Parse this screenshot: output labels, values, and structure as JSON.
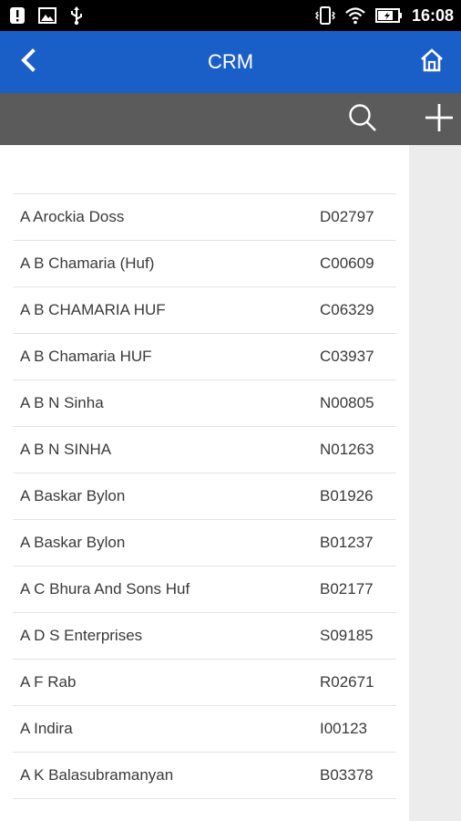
{
  "status_bar": {
    "time": "16:08",
    "left_icons": [
      "alert-icon",
      "image-icon",
      "usb-icon"
    ],
    "right_icons": [
      "vibrate-icon",
      "wifi-icon",
      "battery-icon"
    ]
  },
  "app_bar": {
    "title": "CRM",
    "color": "#1a5fc8",
    "back_icon": "chevron-left-icon",
    "home_icon": "home-icon"
  },
  "toolbar": {
    "color": "#5b5b5b",
    "search_icon": "search-icon",
    "add_icon": "plus-icon"
  },
  "customers": [
    {
      "name": "A Arockia Doss",
      "code": "D02797"
    },
    {
      "name": "A B Chamaria (Huf)",
      "code": "C00609"
    },
    {
      "name": "A B CHAMARIA HUF",
      "code": "C06329"
    },
    {
      "name": "A B Chamaria HUF",
      "code": "C03937"
    },
    {
      "name": "A B N Sinha",
      "code": "N00805"
    },
    {
      "name": "A B N SINHA",
      "code": "N01263"
    },
    {
      "name": "A Baskar Bylon",
      "code": "B01926"
    },
    {
      "name": "A Baskar Bylon",
      "code": "B01237"
    },
    {
      "name": "A C Bhura And Sons Huf",
      "code": "B02177"
    },
    {
      "name": "A D S Enterprises",
      "code": "S09185"
    },
    {
      "name": "A F Rab",
      "code": "R02671"
    },
    {
      "name": "A Indira",
      "code": "I00123"
    },
    {
      "name": "A K Balasubramanyan",
      "code": "B03378"
    }
  ]
}
